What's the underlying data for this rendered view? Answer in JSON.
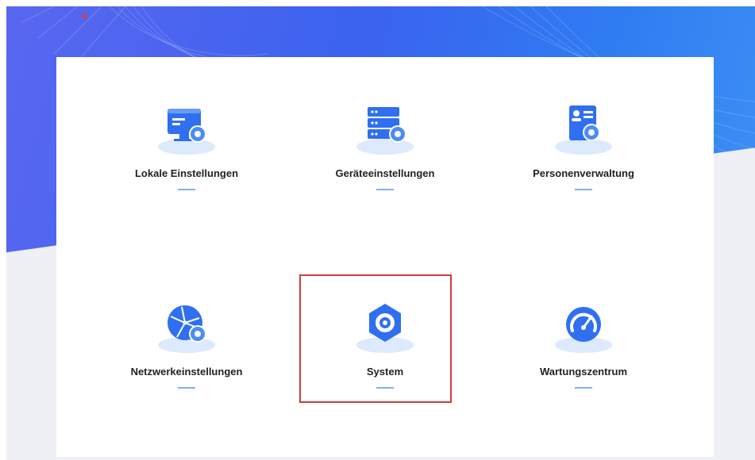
{
  "colors": {
    "banner_start": "#5a67f0",
    "banner_end": "#3e8ff4",
    "icon_primary": "#2f6ff0",
    "icon_light": "#cfe0fb",
    "highlight": "#d43b3b",
    "underline": "#4d8ef0"
  },
  "tiles": [
    {
      "label": "Lokale Einstellungen",
      "icon": "monitor-gear-icon"
    },
    {
      "label": "Geräteeinstellungen",
      "icon": "server-gear-icon"
    },
    {
      "label": "Personenverwaltung",
      "icon": "id-card-gear-icon"
    },
    {
      "label": "Netzwerkeinstellungen",
      "icon": "globe-gear-icon"
    },
    {
      "label": "System",
      "icon": "hexagon-gear-icon",
      "highlighted": true
    },
    {
      "label": "Wartungszentrum",
      "icon": "speedometer-icon"
    }
  ]
}
